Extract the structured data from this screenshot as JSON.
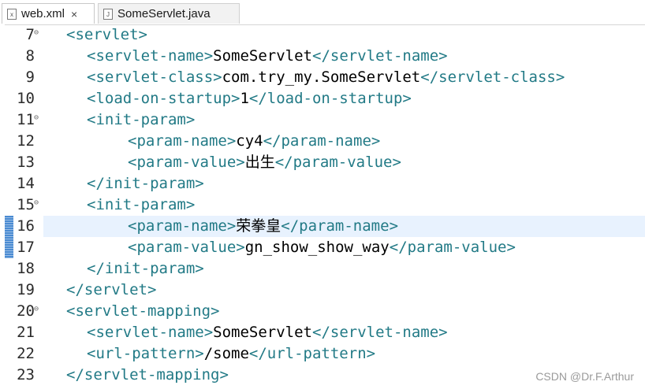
{
  "tabs": [
    {
      "label": "web.xml",
      "icon": "xml-file-icon",
      "active": true,
      "close": "×"
    },
    {
      "label": "SomeServlet.java",
      "icon": "java-file-icon",
      "active": false
    }
  ],
  "colors": {
    "tag": "#227a86",
    "text": "#000000",
    "current_line": "#e8f2fe",
    "change_marker": "#4a8bd2"
  },
  "current_line": 16,
  "changed_lines": [
    16,
    17
  ],
  "lines": [
    {
      "no": "7",
      "fold": true,
      "indent": 0,
      "parts": [
        {
          "t": "tag",
          "v": "<servlet>"
        }
      ]
    },
    {
      "no": "8",
      "fold": false,
      "indent": 1,
      "parts": [
        {
          "t": "tag",
          "v": "<servlet-name>"
        },
        {
          "t": "txt",
          "v": "SomeServlet"
        },
        {
          "t": "tag",
          "v": "</servlet-name>"
        }
      ]
    },
    {
      "no": "9",
      "fold": false,
      "indent": 1,
      "parts": [
        {
          "t": "tag",
          "v": "<servlet-class>"
        },
        {
          "t": "txt",
          "v": "com.try_my.SomeServlet"
        },
        {
          "t": "tag",
          "v": "</servlet-class>"
        }
      ]
    },
    {
      "no": "10",
      "fold": false,
      "indent": 1,
      "parts": [
        {
          "t": "tag",
          "v": "<load-on-startup>"
        },
        {
          "t": "txt",
          "v": "1"
        },
        {
          "t": "tag",
          "v": "</load-on-startup>"
        }
      ]
    },
    {
      "no": "11",
      "fold": true,
      "indent": 1,
      "parts": [
        {
          "t": "tag",
          "v": "<init-param>"
        }
      ]
    },
    {
      "no": "12",
      "fold": false,
      "indent": 3,
      "parts": [
        {
          "t": "tag",
          "v": "<param-name>"
        },
        {
          "t": "txt",
          "v": "cy4"
        },
        {
          "t": "tag",
          "v": "</param-name>"
        }
      ]
    },
    {
      "no": "13",
      "fold": false,
      "indent": 3,
      "parts": [
        {
          "t": "tag",
          "v": "<param-value>"
        },
        {
          "t": "txt",
          "v": "出生"
        },
        {
          "t": "tag",
          "v": "</param-value>"
        }
      ]
    },
    {
      "no": "14",
      "fold": false,
      "indent": 1,
      "parts": [
        {
          "t": "tag",
          "v": "</init-param>"
        }
      ]
    },
    {
      "no": "15",
      "fold": true,
      "indent": 1,
      "parts": [
        {
          "t": "tag",
          "v": "<init-param>"
        }
      ]
    },
    {
      "no": "16",
      "fold": false,
      "indent": 3,
      "parts": [
        {
          "t": "tag",
          "v": "<param-name>"
        },
        {
          "t": "txt",
          "v": "荣拳皇"
        },
        {
          "t": "tag",
          "v": "</param-name>"
        }
      ]
    },
    {
      "no": "17",
      "fold": false,
      "indent": 3,
      "parts": [
        {
          "t": "tag",
          "v": "<param-value>"
        },
        {
          "t": "txt",
          "v": "gn_show_show_way"
        },
        {
          "t": "tag",
          "v": "</param-value>"
        }
      ]
    },
    {
      "no": "18",
      "fold": false,
      "indent": 1,
      "parts": [
        {
          "t": "tag",
          "v": "</init-param>"
        }
      ]
    },
    {
      "no": "19",
      "fold": false,
      "indent": 0,
      "parts": [
        {
          "t": "tag",
          "v": "</servlet>"
        }
      ]
    },
    {
      "no": "20",
      "fold": true,
      "indent": 0,
      "parts": [
        {
          "t": "tag",
          "v": "<servlet-mapping>"
        }
      ]
    },
    {
      "no": "21",
      "fold": false,
      "indent": 1,
      "parts": [
        {
          "t": "tag",
          "v": "<servlet-name>"
        },
        {
          "t": "txt",
          "v": "SomeServlet"
        },
        {
          "t": "tag",
          "v": "</servlet-name>"
        }
      ]
    },
    {
      "no": "22",
      "fold": false,
      "indent": 1,
      "parts": [
        {
          "t": "tag",
          "v": "<url-pattern>"
        },
        {
          "t": "txt",
          "v": "/some"
        },
        {
          "t": "tag",
          "v": "</url-pattern>"
        }
      ]
    },
    {
      "no": "23",
      "fold": false,
      "indent": 0,
      "parts": [
        {
          "t": "tag",
          "v": "</servlet-mapping>"
        }
      ]
    }
  ],
  "watermark": "CSDN @Dr.F.Arthur"
}
